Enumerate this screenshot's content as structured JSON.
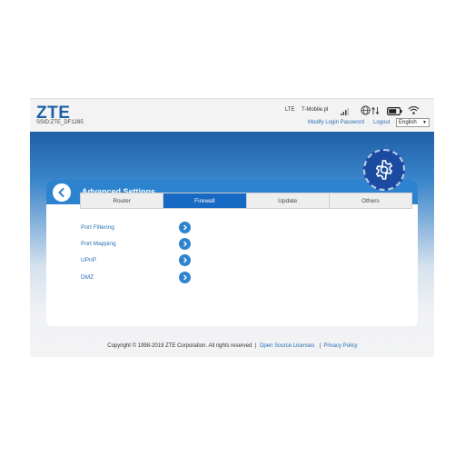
{
  "header": {
    "logo": "ZTE",
    "ssid": "SSID:ZTE_DF1285",
    "network_type": "LTE",
    "operator": "T-Mobile.pl",
    "links": [
      "Modify Login Password",
      "Logout"
    ],
    "language": "English"
  },
  "page": {
    "title": "Advanced Settings"
  },
  "tabs": [
    {
      "label": "Router",
      "active": false
    },
    {
      "label": "Firewall",
      "active": true
    },
    {
      "label": "Update",
      "active": false
    },
    {
      "label": "Others",
      "active": false
    }
  ],
  "menu_items": [
    "Port Filtering",
    "Port Mapping",
    "UPnP",
    "DMZ"
  ],
  "footer": {
    "copyright": "Copyright © 1998-2019 ZTE Corporation. All rights reserved",
    "separator": "|",
    "links": [
      "Open Source Licenses",
      "Privacy Policy"
    ]
  },
  "colors": {
    "brand_blue": "#1d5fa8",
    "header_blue": "#2e83cf",
    "active_tab": "#1869c3",
    "link": "#2a6fb5"
  },
  "icons": [
    "signal-icon",
    "globe-icon",
    "data-transfer-icon",
    "battery-icon",
    "wifi-icon",
    "back-icon",
    "gear-icon",
    "chevron-right-icon"
  ]
}
